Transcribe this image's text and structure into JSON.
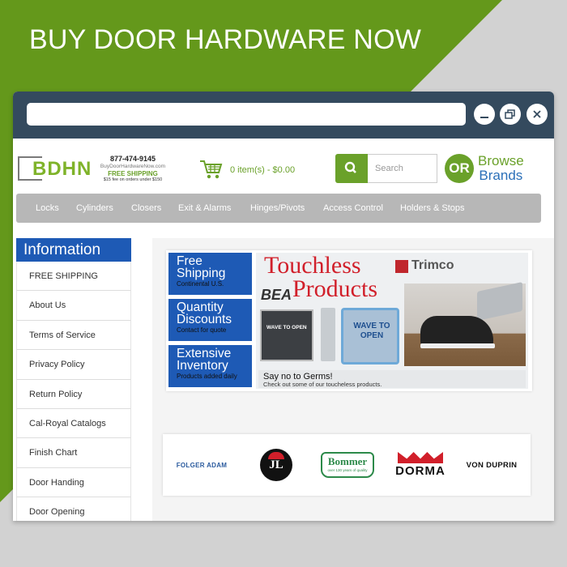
{
  "promo": {
    "title": "BUY DOOR HARDWARE NOW"
  },
  "window": {
    "minimize_icon": "minimize-icon",
    "restore_icon": "restore-icon",
    "close_icon": "close-icon"
  },
  "header": {
    "logo_text": "BDHN",
    "phone": "877-474-9145",
    "site_url": "BuyDoorHardwareNow.com",
    "free_shipping": "FREE SHIPPING",
    "free_shipping_note": "$15 fee on orders under $150",
    "cart_text": "0 item(s) - $0.00",
    "search_placeholder": "Search",
    "or_label": "OR",
    "browse_line1": "Browse",
    "browse_line2": "Brands"
  },
  "nav": [
    "Locks",
    "Cylinders",
    "Closers",
    "Exit & Alarms",
    "Hinges/Pivots",
    "Access Control",
    "Holders & Stops"
  ],
  "sidebar": {
    "title": "Information",
    "items": [
      "FREE SHIPPING",
      "About Us",
      "Terms of Service",
      "Privacy Policy",
      "Return Policy",
      "Cal-Royal Catalogs",
      "Finish Chart",
      "Door Handing",
      "Door Opening"
    ]
  },
  "banner": {
    "boxes": [
      {
        "h1": "Free",
        "h2": "Shipping",
        "sub": "Continental U.S."
      },
      {
        "h1": "Quantity",
        "h2": "Discounts",
        "sub": "Contact for quote"
      },
      {
        "h1": "Extensive",
        "h2": "Inventory",
        "sub": "Products added daily"
      }
    ],
    "title1": "Touchless",
    "title2": "Products",
    "trimco": "Trimco",
    "bea": "BEA",
    "plate1_text": "WAVE TO OPEN",
    "plate3_text": "WAVE TO OPEN",
    "germs_title": "Say no to Germs!",
    "germs_sub": "Check out some of our toucheless products."
  },
  "brands": {
    "folger": "FOLGER ADAM",
    "jl": "JL",
    "bommer": "Bommer",
    "bommer_sub": "over 130 years of quality",
    "dorma": "DORMA",
    "vonduprin": "VON DUPRIN"
  },
  "colors": {
    "green": "#6aa12a",
    "blue": "#1e5ab5",
    "titlebar": "#344a5e",
    "red": "#d11f2a"
  }
}
